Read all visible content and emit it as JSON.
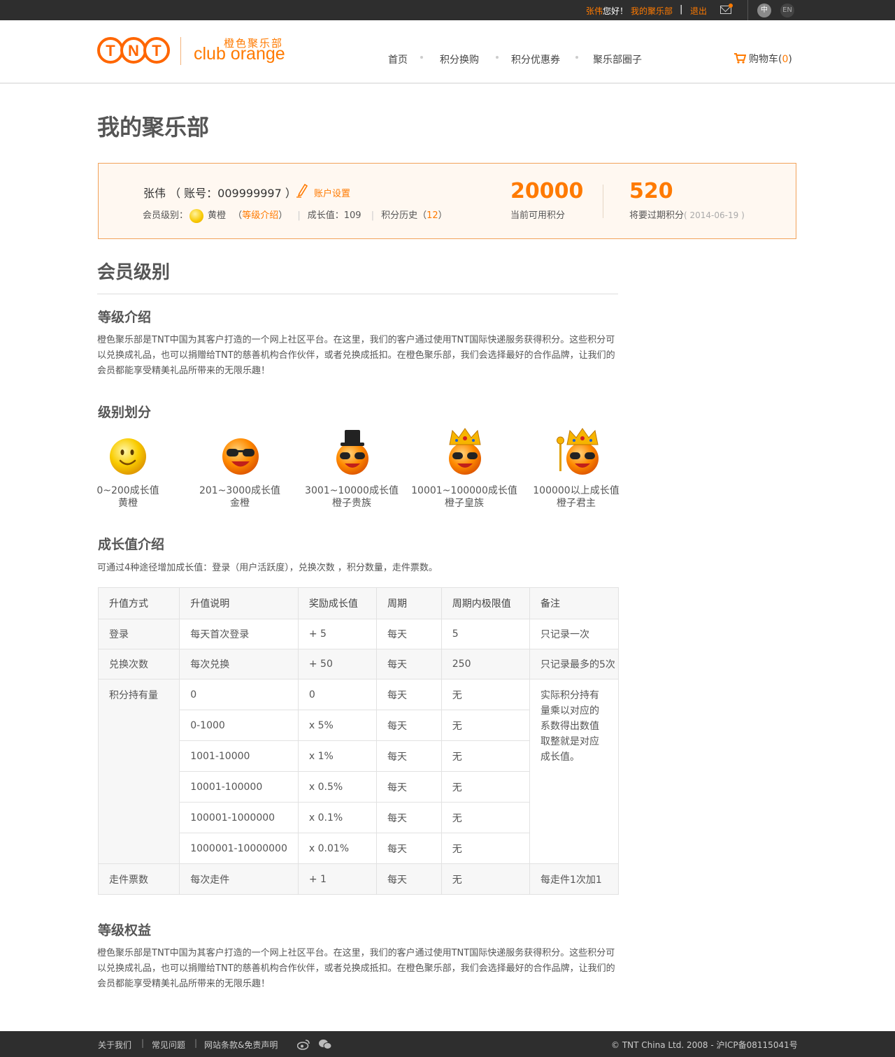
{
  "topbar": {
    "user_name": "张伟",
    "greeting": "您好！",
    "my_club": "我的聚乐部",
    "separator": "|",
    "logout": "退出",
    "lang_zh": "中",
    "lang_en": "EN"
  },
  "header": {
    "logo_text": "TNT",
    "club_cn": "橙色聚乐部",
    "club_en": "club orange",
    "nav": [
      "首页",
      "积分换购",
      "积分优惠券",
      "聚乐部圈子"
    ],
    "cart_label": "购物车",
    "cart_count": "0"
  },
  "page": {
    "title": "我的聚乐部"
  },
  "profile": {
    "name_line": "张伟 （ 账号：009999997 ）",
    "settings": "账户设置",
    "level_label": "会员级别：",
    "level_name": "黄橙",
    "level_intro_open": "（",
    "level_intro": "等级介绍",
    "level_intro_close": "）",
    "growth": "成长值：109",
    "history_label": "积分历史（",
    "history_count": "12",
    "history_close": "）",
    "points_available": "20000",
    "points_available_label": "当前可用积分",
    "points_expiring": "520",
    "points_expiring_label": "将要过期积分",
    "expire_date": "( 2014-06-19 )"
  },
  "membership": {
    "section_title": "会员级别",
    "intro_title": "等级介绍",
    "intro_text": "橙色聚乐部是TNT中国为其客户打造的一个网上社区平台。在这里，我们的客户通过使用TNT国际快递服务获得积分。这些积分可以兑换成礼品，也可以捐赠给TNT的慈善机构合作伙伴，或者兑换成抵扣。在橙色聚乐部，我们会选择最好的合作品牌，让我们的会员都能享受精美礼品所带来的无限乐趣！",
    "levels_title": "级别划分",
    "levels": [
      {
        "range": "0~200成长值",
        "name": "黄橙",
        "icon": "smiley-icon"
      },
      {
        "range": "201~3000成长值",
        "name": "金橙",
        "icon": "sunglasses-icon"
      },
      {
        "range": "3001~10000成长值",
        "name": "橙子贵族",
        "icon": "tophat-icon"
      },
      {
        "range": "10001~100000成长值",
        "name": "橙子皇族",
        "icon": "crown-icon"
      },
      {
        "range": "100000以上成长值",
        "name": "橙子君主",
        "icon": "crown-scepter-icon"
      }
    ],
    "growth_title": "成长值介绍",
    "growth_text": "可通过4种途径增加成长值：登录（用户活跃度），兑换次数 ，积分数量，走件票数。",
    "table": {
      "headers": [
        "升值方式",
        "升值说明",
        "奖励成长值",
        "周期",
        "周期内极限值",
        "备注"
      ],
      "login": [
        "登录",
        "每天首次登录",
        "+ 5",
        "每天",
        "5",
        "只记录一次"
      ],
      "exchange": [
        "兑换次数",
        "每次兑换",
        "+ 50",
        "每天",
        "250",
        "只记录最多的5次"
      ],
      "holding_label": "积分持有量",
      "holding_note": "实际积分持有量乘以对应的系数得出数值取整就是对应成长值。",
      "holding_rows": [
        [
          "0",
          "0",
          "每天",
          "无"
        ],
        [
          "0-1000",
          "x 5%",
          "每天",
          "无"
        ],
        [
          "1001-10000",
          "x 1%",
          "每天",
          "无"
        ],
        [
          "10001-100000",
          "x 0.5%",
          "每天",
          "无"
        ],
        [
          "100001-1000000",
          "x 0.1%",
          "每天",
          "无"
        ],
        [
          "1000001-10000000",
          "x 0.01%",
          "每天",
          "无"
        ]
      ],
      "shipments": [
        "走件票数",
        "每次走件",
        "+ 1",
        "每天",
        "无",
        "每走件1次加1"
      ]
    },
    "benefits_title": "等级权益",
    "benefits_text": "橙色聚乐部是TNT中国为其客户打造的一个网上社区平台。在这里，我们的客户通过使用TNT国际快递服务获得积分。这些积分可以兑换成礼品，也可以捐赠给TNT的慈善机构合作伙伴，或者兑换成抵扣。在橙色聚乐部，我们会选择最好的合作品牌，让我们的会员都能享受精美礼品所带来的无限乐趣！"
  },
  "footer": {
    "links": [
      "关于我们",
      "常见问题",
      "网站条款&免责声明"
    ],
    "separator": "|",
    "copyright": "© TNT China Ltd. 2008 - 沪ICP备08115041号"
  },
  "colors": {
    "accent": "#ff7a00",
    "dark_bar": "#2e2e2e",
    "profile_bg": "#fff8f1"
  }
}
